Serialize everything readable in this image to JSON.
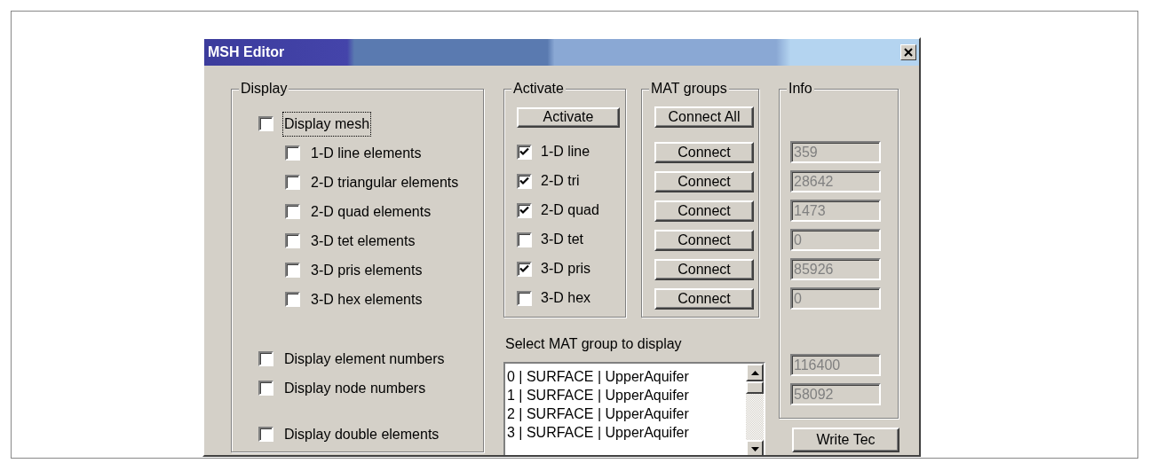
{
  "window": {
    "title": "MSH Editor"
  },
  "display": {
    "title": "Display",
    "mesh": {
      "label": "Display mesh",
      "checked": false,
      "focused": true
    },
    "element_types": [
      {
        "label": "1-D line elements",
        "checked": false
      },
      {
        "label": "2-D triangular elements",
        "checked": false
      },
      {
        "label": "2-D quad elements",
        "checked": false
      },
      {
        "label": "3-D tet elements",
        "checked": false
      },
      {
        "label": "3-D pris elements",
        "checked": false
      },
      {
        "label": "3-D hex elements",
        "checked": false
      }
    ],
    "options": [
      {
        "label": "Display element numbers",
        "checked": false
      },
      {
        "label": "Display node numbers",
        "checked": false
      },
      {
        "label": "Display double elements",
        "checked": false
      }
    ]
  },
  "activate": {
    "title": "Activate",
    "button": "Activate",
    "types": [
      {
        "label": "1-D line",
        "checked": true
      },
      {
        "label": "2-D tri",
        "checked": true
      },
      {
        "label": "2-D quad",
        "checked": true
      },
      {
        "label": "3-D tet",
        "checked": false
      },
      {
        "label": "3-D pris",
        "checked": true
      },
      {
        "label": "3-D hex",
        "checked": false
      }
    ]
  },
  "mat_groups": {
    "title": "MAT groups",
    "connect_all": "Connect All",
    "buttons": [
      "Connect",
      "Connect",
      "Connect",
      "Connect",
      "Connect",
      "Connect"
    ]
  },
  "mat_list": {
    "label": "Select MAT group to display",
    "items": [
      {
        "text": "0 | SURFACE | UpperAquifer",
        "selected": false
      },
      {
        "text": "1 | SURFACE | UpperAquifer",
        "selected": false
      },
      {
        "text": "2 | SURFACE | UpperAquifer",
        "selected": false
      },
      {
        "text": "3 | SURFACE | UpperAquifer",
        "selected": false
      }
    ]
  },
  "info": {
    "title": "Info",
    "disabled": true,
    "fields": [
      {
        "value": "359"
      },
      {
        "value": "28642"
      },
      {
        "value": "1473"
      },
      {
        "value": "0"
      },
      {
        "value": "85926"
      },
      {
        "value": "0"
      }
    ],
    "totals": [
      {
        "value": "116400"
      },
      {
        "value": "58092"
      }
    ]
  },
  "write_button": "Write Tec"
}
